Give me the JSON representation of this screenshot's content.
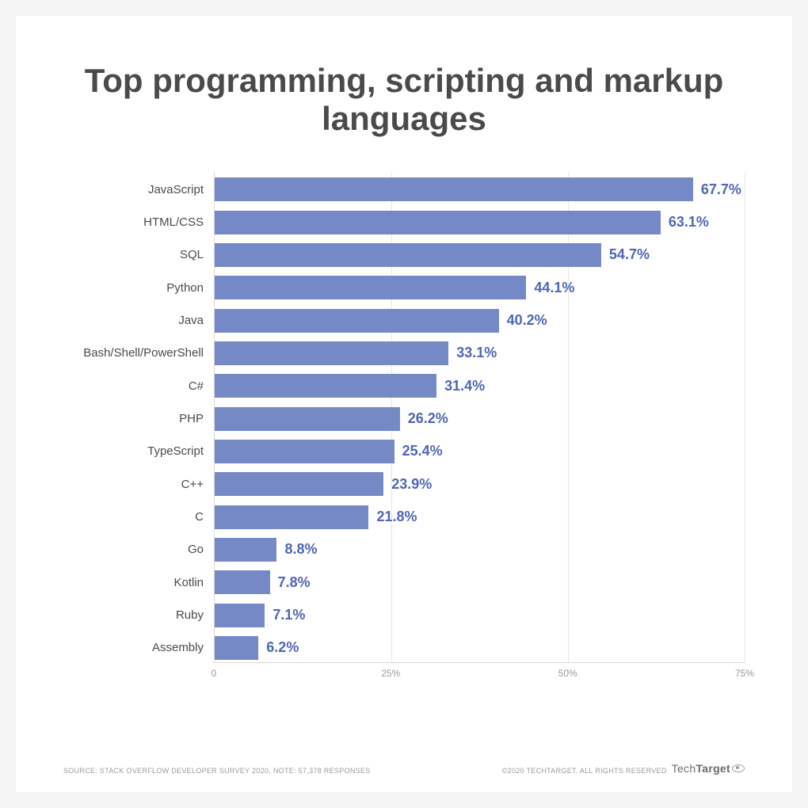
{
  "chart_data": {
    "type": "bar",
    "title": "Top programming, scripting and markup languages",
    "categories": [
      "JavaScript",
      "HTML/CSS",
      "SQL",
      "Python",
      "Java",
      "Bash/Shell/PowerShell",
      "C#",
      "PHP",
      "TypeScript",
      "C++",
      "C",
      "Go",
      "Kotlin",
      "Ruby",
      "Assembly"
    ],
    "values": [
      67.7,
      63.1,
      54.7,
      44.1,
      40.2,
      33.1,
      31.4,
      26.2,
      25.4,
      23.9,
      21.8,
      8.8,
      7.8,
      7.1,
      6.2
    ],
    "value_labels": [
      "67.7%",
      "63.1%",
      "54.7%",
      "44.1%",
      "40.2%",
      "33.1%",
      "31.4%",
      "26.2%",
      "25.4%",
      "23.9%",
      "21.8%",
      "8.8%",
      "7.8%",
      "7.1%",
      "6.2%"
    ],
    "xlabel": "",
    "ylabel": "",
    "xlim": [
      0,
      75
    ],
    "xticks": [
      0,
      25,
      50,
      75
    ],
    "xtick_labels": [
      "0",
      "25%",
      "50%",
      "75%"
    ]
  },
  "footer": {
    "source": "SOURCE: STACK OVERFLOW DEVELOPER SURVEY 2020, NOTE: 57,378 RESPONSES",
    "copyright": "©2020 TECHTARGET. ALL RIGHTS RESERVED",
    "brand_prefix": "Tech",
    "brand_suffix": "Target"
  },
  "colors": {
    "bar": "#7689c7",
    "value_label": "#4f67b2"
  }
}
